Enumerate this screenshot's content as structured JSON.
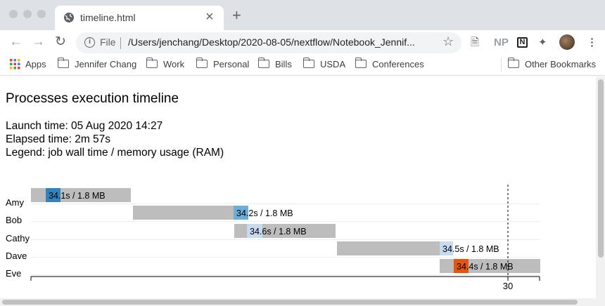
{
  "browser": {
    "tab_title": "timeline.html",
    "tab_close": "×",
    "new_tab": "+",
    "url_scheme": "File",
    "url": "/Users/jenchang/Desktop/2020-08-05/nextflow/Notebook_Jennif...",
    "ext_np": "NP",
    "ext_n": "N",
    "bookmarks": [
      "Apps",
      "Jennifer Chang",
      "Work",
      "Personal",
      "Bills",
      "USDA",
      "Conferences"
    ],
    "other_bookmarks": "Other Bookmarks"
  },
  "report": {
    "title": "Processes execution timeline",
    "launch": "Launch time: 05 Aug 2020 14:27",
    "elapsed": "Elapsed time: 2m 57s",
    "legend": "Legend: job wall time / memory usage (RAM)"
  },
  "timeline": {
    "x_ticks": [
      30
    ],
    "rows": [
      {
        "name": "Amy",
        "label": "34.1s / 1.8 MB",
        "run_color": "#3182bd"
      },
      {
        "name": "Bob",
        "label": "34.2s / 1.8 MB",
        "run_color": "#6baed6"
      },
      {
        "name": "Cathy",
        "label": "34.6s / 1.8 MB",
        "run_color": "#c6dbef"
      },
      {
        "name": "Dave",
        "label": "34.5s / 1.8 MB",
        "run_color": "#c6dbef"
      },
      {
        "name": "Eve",
        "label": "34.4s / 1.8 MB",
        "run_color": "#e6550d"
      }
    ],
    "pending_color": "#bdbdbd"
  }
}
